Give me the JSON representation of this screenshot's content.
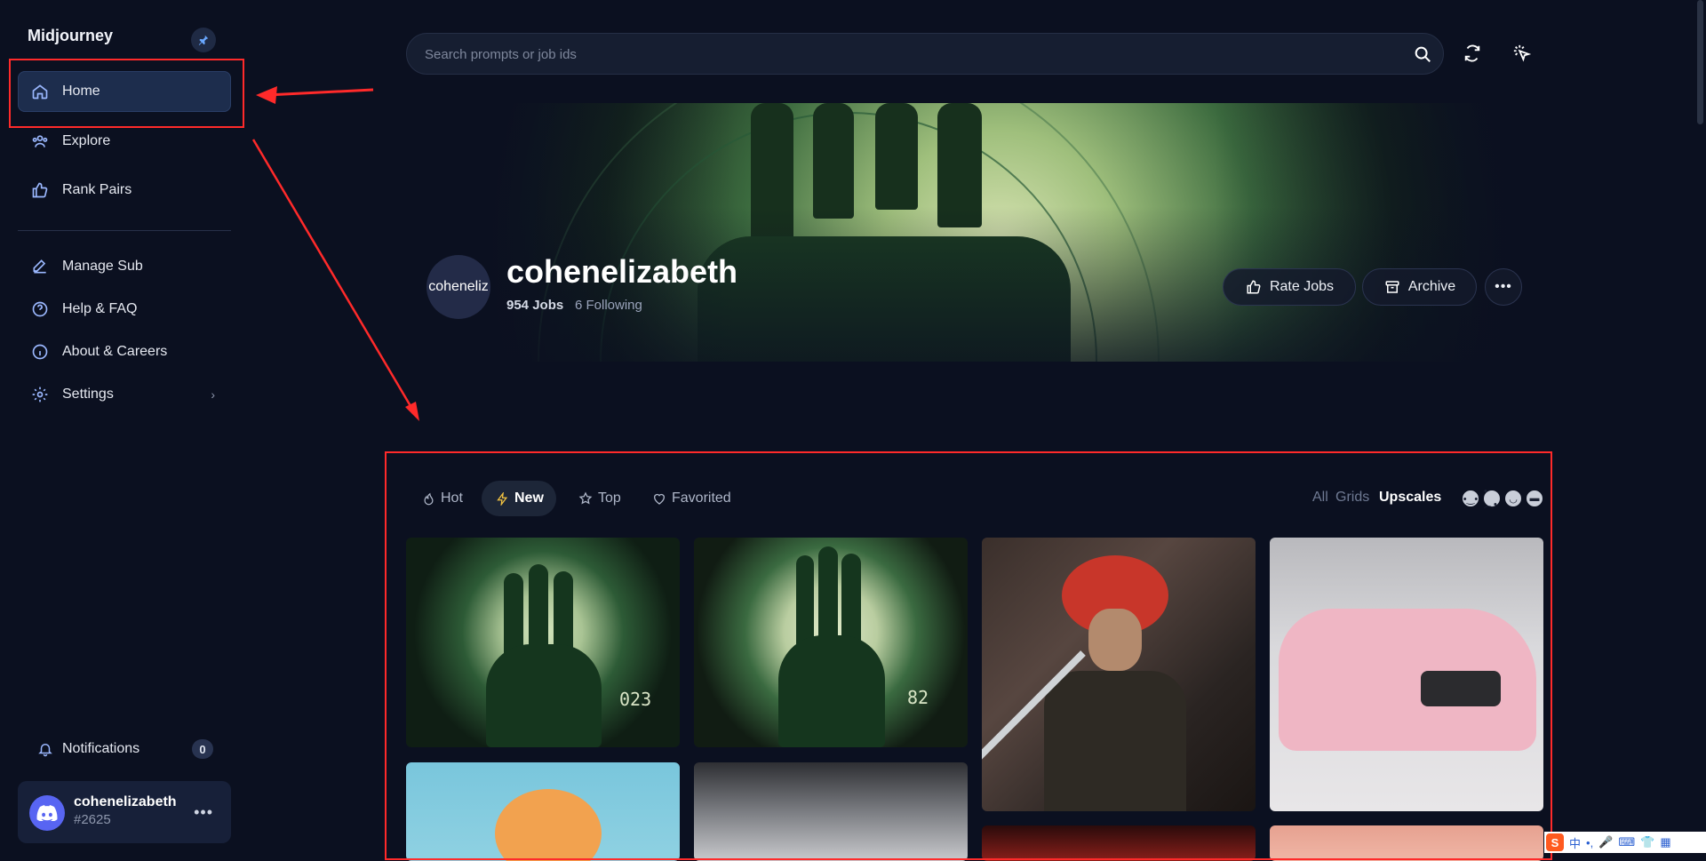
{
  "app": {
    "name": "Midjourney"
  },
  "sidebar": {
    "items": [
      {
        "label": "Home",
        "icon": "home-icon"
      },
      {
        "label": "Explore",
        "icon": "people-icon"
      },
      {
        "label": "Rank Pairs",
        "icon": "thumbs-up-icon"
      },
      {
        "label": "Manage Sub",
        "icon": "edit-icon"
      },
      {
        "label": "Help & FAQ",
        "icon": "help-icon"
      },
      {
        "label": "About & Careers",
        "icon": "info-icon"
      },
      {
        "label": "Settings",
        "icon": "gear-icon"
      }
    ],
    "notifications": {
      "label": "Notifications",
      "count": "0"
    },
    "user": {
      "name": "cohenelizabeth",
      "tag": "#2625"
    }
  },
  "search": {
    "placeholder": "Search prompts or job ids"
  },
  "profile": {
    "avatar_alt": "coheneliz",
    "name": "cohenelizabeth",
    "jobs": "954 Jobs",
    "following": "6 Following",
    "rate_jobs": "Rate Jobs",
    "archive": "Archive"
  },
  "filters": {
    "tabs": [
      {
        "label": "Hot",
        "icon": "fire-icon"
      },
      {
        "label": "New",
        "icon": "bolt-icon"
      },
      {
        "label": "Top",
        "icon": "star-icon"
      },
      {
        "label": "Favorited",
        "icon": "heart-icon"
      }
    ],
    "active_tab": "New",
    "views": [
      "All",
      "Grids",
      "Upscales"
    ],
    "active_view": "Upscales"
  },
  "grid": {
    "tile_labels": [
      "023",
      "82"
    ]
  },
  "ime": {
    "label": "中"
  },
  "colors": {
    "background": "#0b1020",
    "active_nav": "#1d2d4d",
    "annotation": "#ff2a2a",
    "accent_bolt": "#f5c542",
    "discord": "#5865f2"
  }
}
